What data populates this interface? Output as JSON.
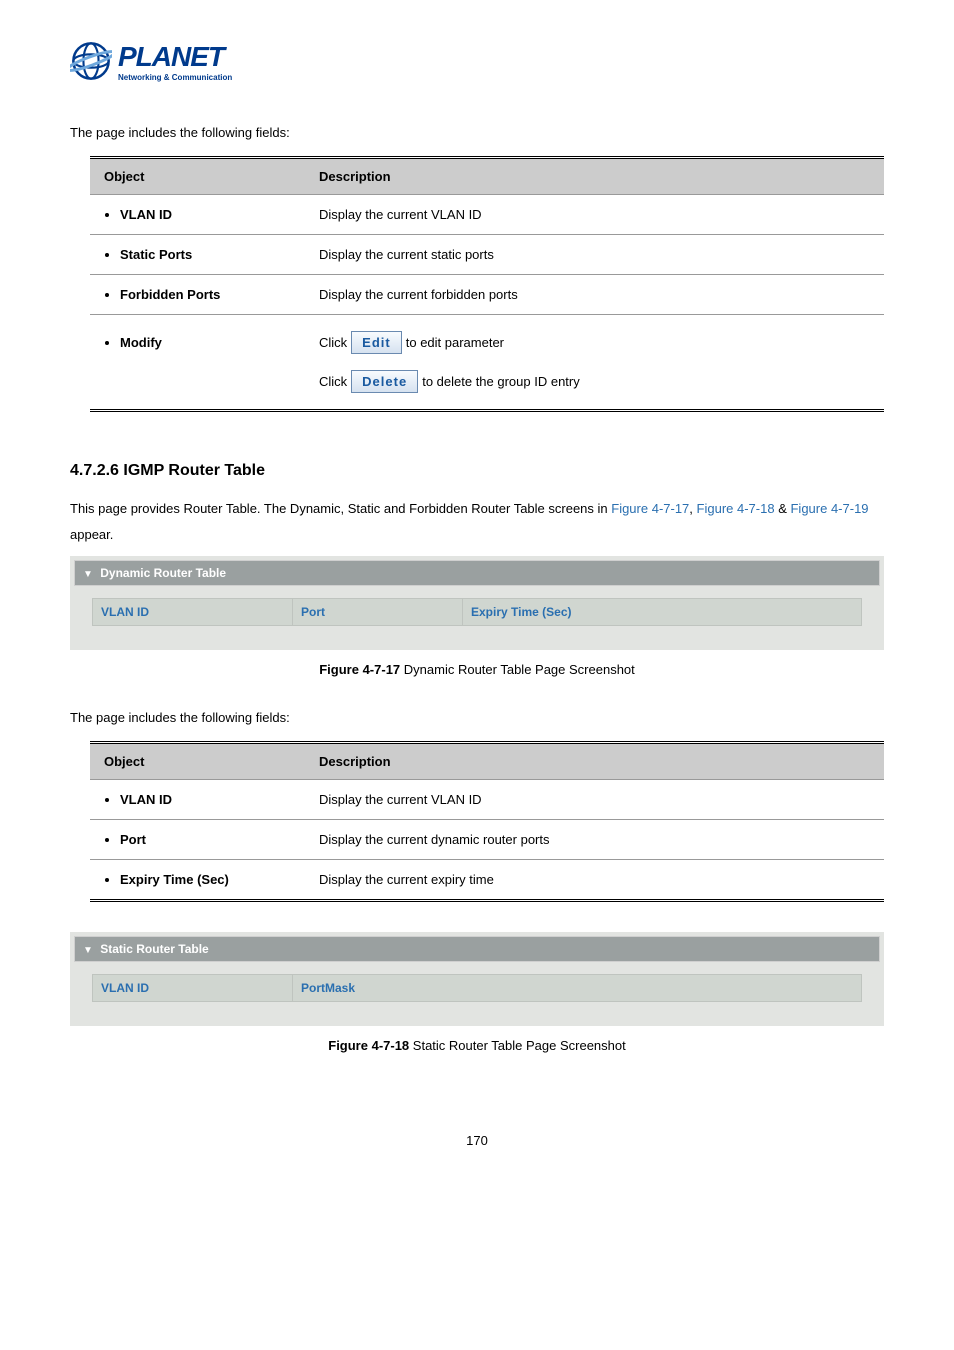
{
  "logo": {
    "main": "PLANET",
    "sub": "Networking & Communication"
  },
  "intro1": "The page includes the following fields:",
  "table1": {
    "headers": {
      "obj": "Object",
      "desc": "Description"
    },
    "rows": [
      {
        "obj": "VLAN ID",
        "desc": "Display the current VLAN ID"
      },
      {
        "obj": "Static Ports",
        "desc": "Display the current static ports"
      },
      {
        "obj": "Forbidden Ports",
        "desc": "Display the current forbidden ports"
      },
      {
        "obj": "Modify",
        "desc_click1_pre": "Click",
        "desc_btn1": "Edit",
        "desc_click1_post": "to edit parameter",
        "desc_click2_pre": "Click",
        "desc_btn2": "Delete",
        "desc_click2_post": "to delete the group ID entry"
      }
    ]
  },
  "section_heading": "4.7.2.6 IGMP Router Table",
  "section_para_pre": "This page provides Router Table. The Dynamic, Static and Forbidden Router Table screens in ",
  "fig_link1": "Figure 4-7-17",
  "comma1": ", ",
  "fig_link2": "Figure 4-7-18",
  "amp": " & ",
  "fig_link3": "Figure 4-7-19",
  "section_para_post": " appear.",
  "panel1": {
    "title": "Dynamic Router Table",
    "cols": {
      "c1": "VLAN ID",
      "c2": "Port",
      "c3": "Expiry Time (Sec)"
    }
  },
  "fig1_caption_b": "Figure 4-7-17",
  "fig1_caption": " Dynamic Router Table Page Screenshot",
  "intro2": "The page includes the following fields:",
  "table2": {
    "headers": {
      "obj": "Object",
      "desc": "Description"
    },
    "rows": [
      {
        "obj": "VLAN ID",
        "desc": "Display the current VLAN ID"
      },
      {
        "obj": "Port",
        "desc": "Display the current dynamic router ports"
      },
      {
        "obj": "Expiry Time (Sec)",
        "desc": "Display the current expiry time"
      }
    ]
  },
  "panel2": {
    "title": "Static Router Table",
    "cols": {
      "c1": "VLAN ID",
      "c2": "PortMask"
    }
  },
  "fig2_caption_b": "Figure 4-7-18",
  "fig2_caption": " Static Router Table Page Screenshot",
  "page_number": "170"
}
